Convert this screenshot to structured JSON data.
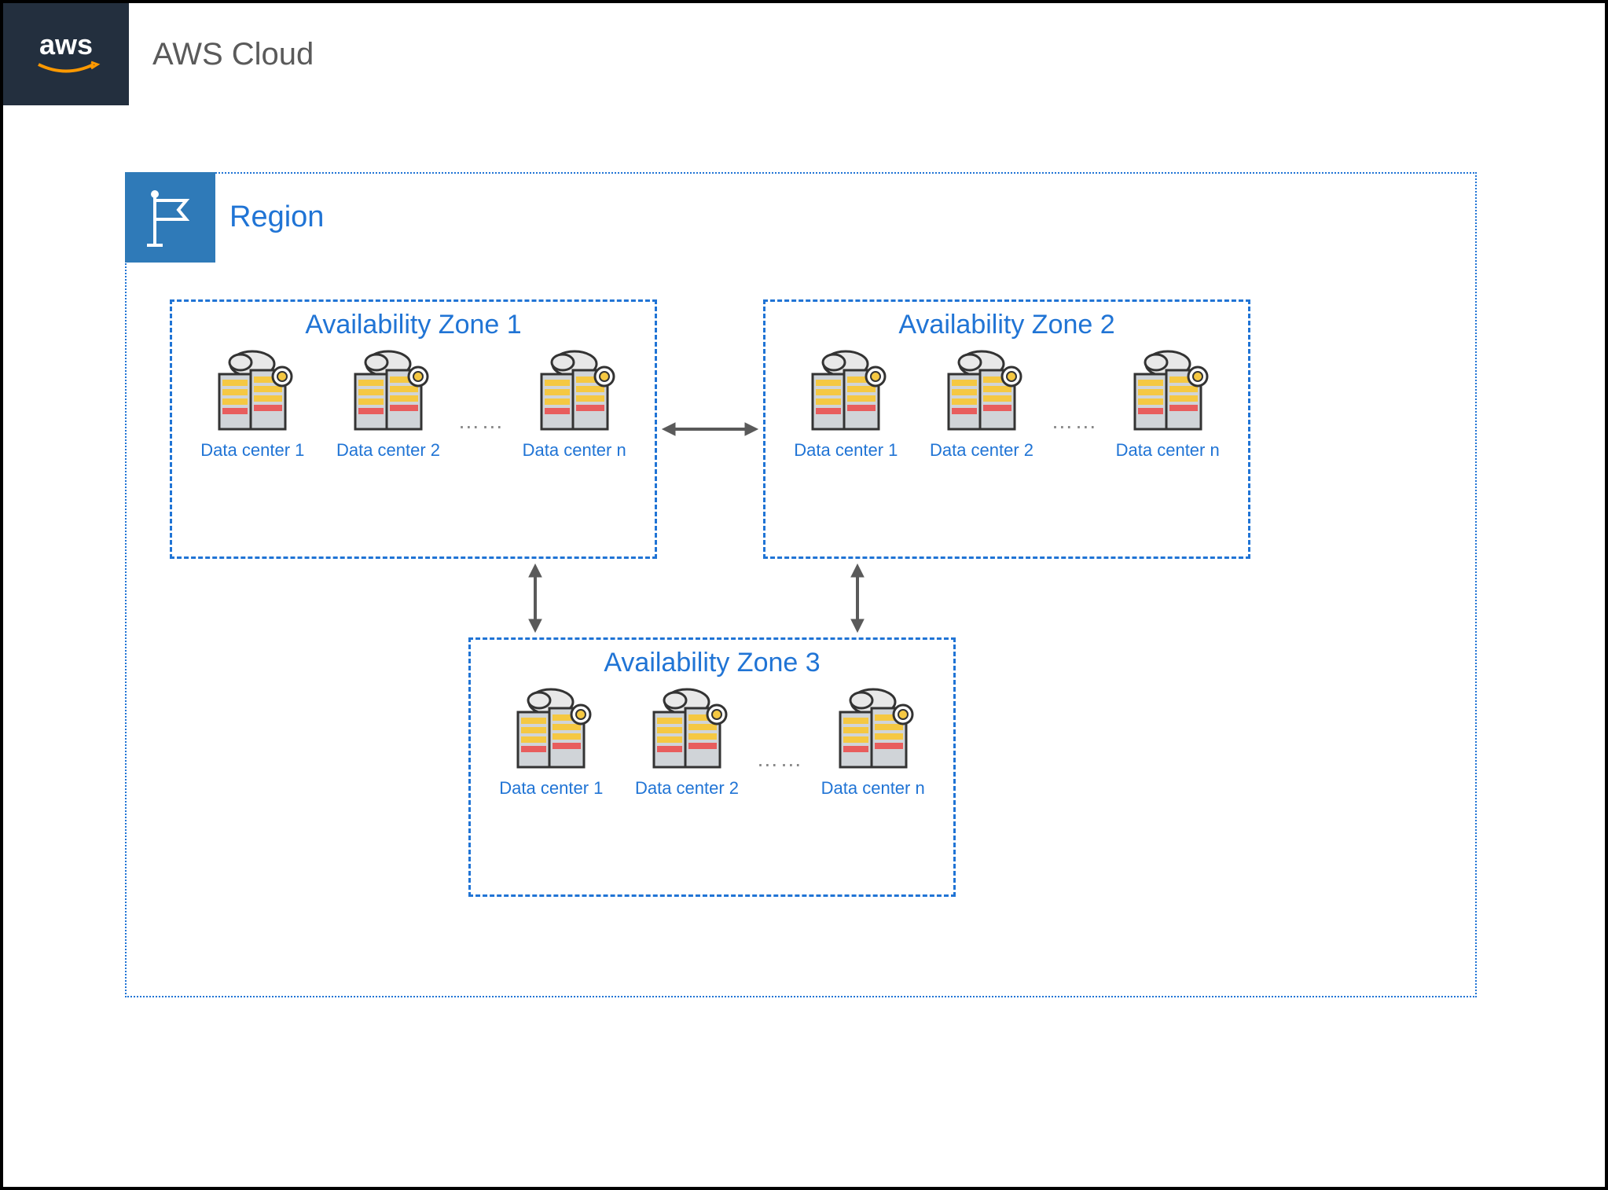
{
  "header": {
    "logo_text": "aws",
    "cloud_label": "AWS Cloud"
  },
  "region": {
    "label": "Region"
  },
  "az1": {
    "title": "Availability Zone 1",
    "dc1": "Data center 1",
    "dc2": "Data center 2",
    "dcn": "Data center n",
    "ellipsis": "……"
  },
  "az2": {
    "title": "Availability Zone 2",
    "dc1": "Data center 1",
    "dc2": "Data center 2",
    "dcn": "Data center n",
    "ellipsis": "……"
  },
  "az3": {
    "title": "Availability Zone 3",
    "dc1": "Data center 1",
    "dc2": "Data center 2",
    "dcn": "Data center n",
    "ellipsis": "……"
  }
}
